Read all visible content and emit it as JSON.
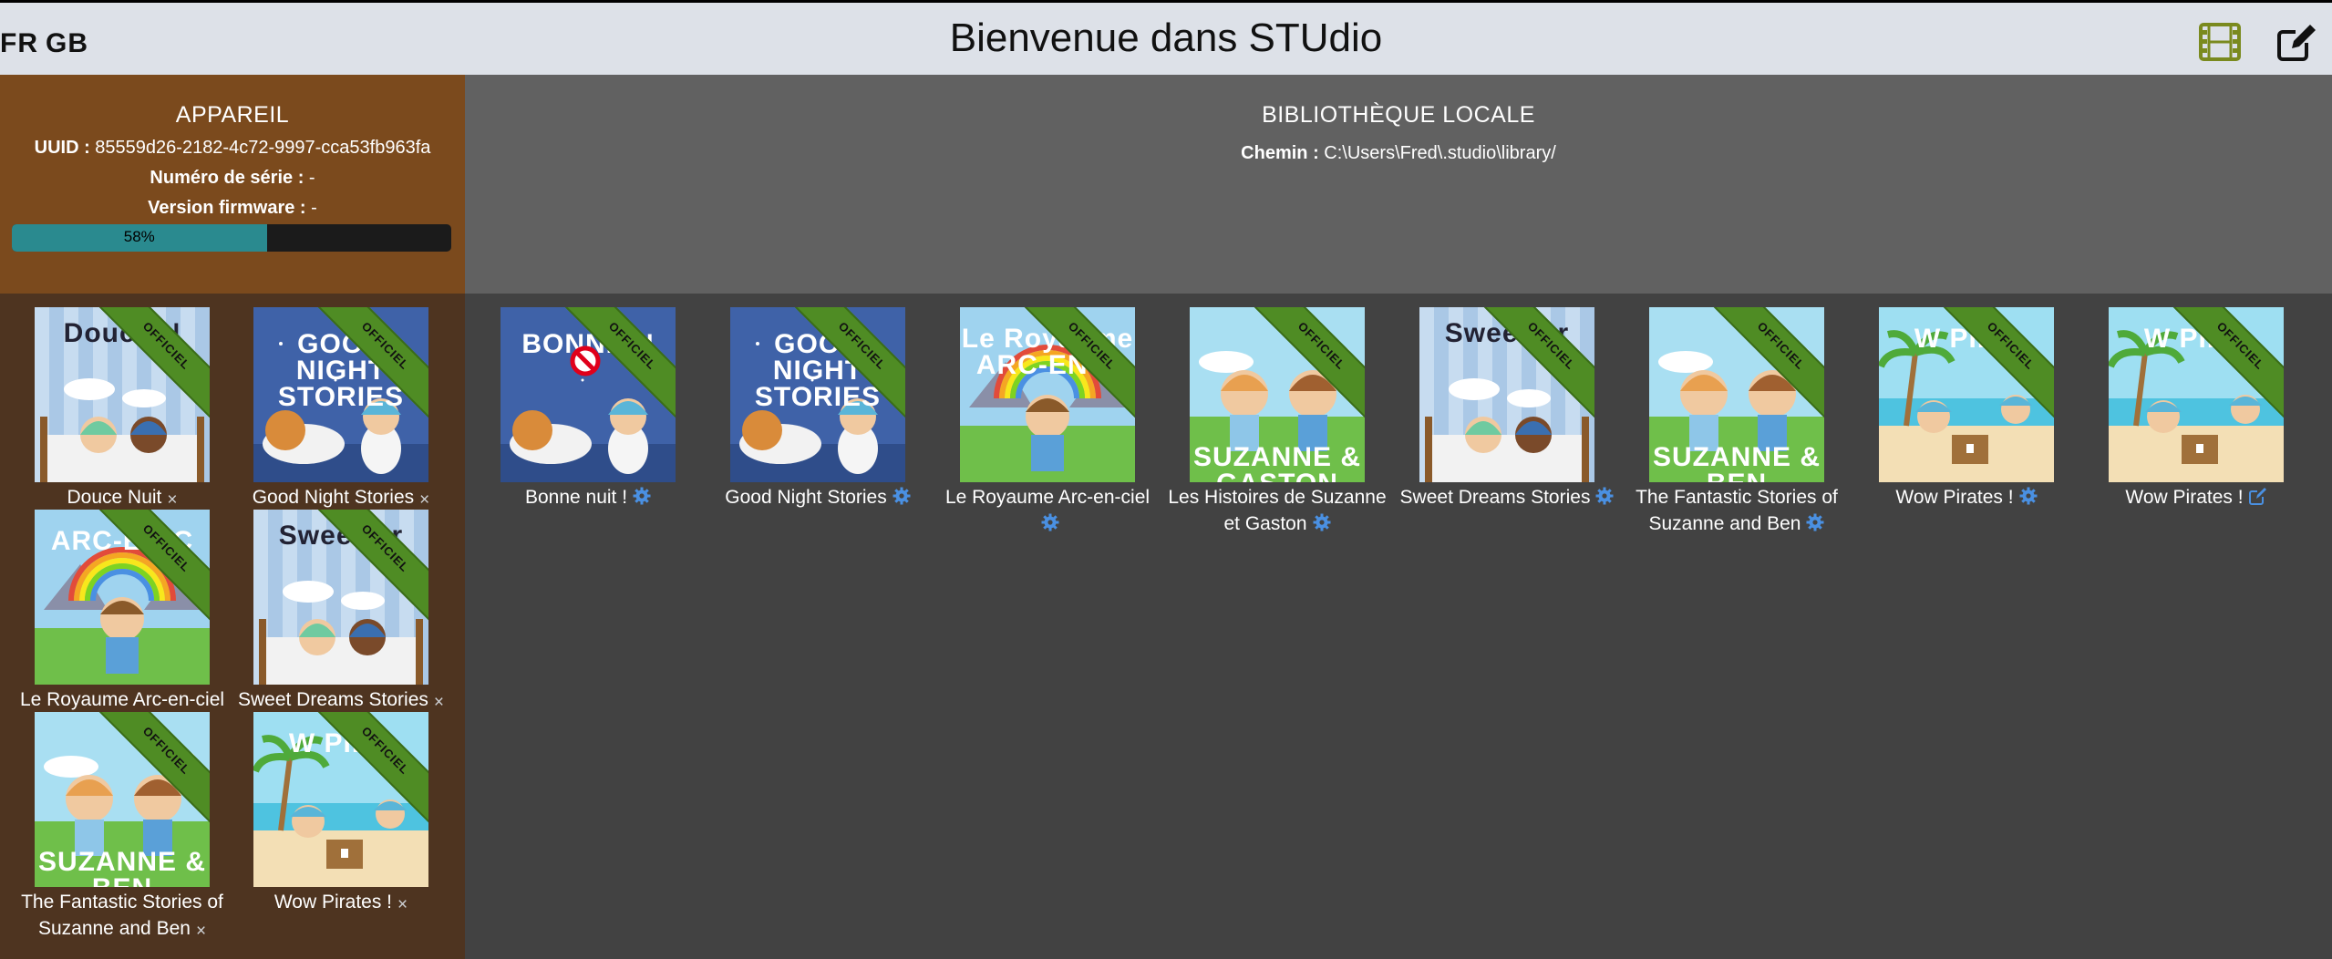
{
  "header": {
    "languages": [
      "FR",
      "GB"
    ],
    "title": "Bienvenue dans STUdio"
  },
  "device": {
    "title": "APPAREIL",
    "uuid_label": "UUID :",
    "uuid": "85559d26-2182-4c72-9997-cca53fb963fa",
    "serial_label": "Numéro de série :",
    "serial": "-",
    "firmware_label": "Version firmware :",
    "firmware": "-",
    "storage_percent": 58,
    "storage_text": "58%"
  },
  "library": {
    "title": "BIBLIOTHÈQUE LOCALE",
    "path_label": "Chemin :",
    "path": "C:\\Users\\Fred\\.studio\\library/"
  },
  "badge": "OFFICIEL",
  "device_packs": [
    {
      "label": "Douce Nuit",
      "cover": "sweet",
      "cover_text": "Douce N",
      "action": "remove"
    },
    {
      "label": "Good Night Stories",
      "cover": "night",
      "cover_text": "GOOD NIGHT STORIES",
      "action": "remove"
    },
    {
      "label": "Le Royaume Arc-en-ciel",
      "cover": "rainbow",
      "cover_text": "ARC-EN-C",
      "action": "remove"
    },
    {
      "label": "Sweet Dreams Stories",
      "cover": "sweet",
      "cover_text": "Sweet Dr",
      "action": "remove"
    },
    {
      "label": "The Fantastic Stories of Suzanne and Ben",
      "cover": "suzanne",
      "cover_text": "SUZANNE & BEN",
      "action": "remove"
    },
    {
      "label": "Wow Pirates !",
      "cover": "pirates",
      "cover_text": "W PIRA",
      "action": "remove"
    }
  ],
  "library_packs": [
    {
      "label": "Bonne nuit !",
      "cover": "night",
      "cover_text": "BONNE N",
      "action": "settings",
      "blocked": true
    },
    {
      "label": "Good Night Stories",
      "cover": "night",
      "cover_text": "GOOD NIGHT STORIES",
      "action": "settings"
    },
    {
      "label": "Le Royaume Arc-en-ciel",
      "cover": "rainbow",
      "cover_text": "Le Royaume ARC-EN-C",
      "action": "settings"
    },
    {
      "label": "Les Histoires de Suzanne et Gaston",
      "cover": "suzanne",
      "cover_text": "SUZANNE & GASTON",
      "action": "settings"
    },
    {
      "label": "Sweet Dreams Stories",
      "cover": "sweet",
      "cover_text": "Sweet Dr",
      "action": "settings"
    },
    {
      "label": "The Fantastic Stories of Suzanne and Ben",
      "cover": "suzanne",
      "cover_text": "SUZANNE & BEN",
      "action": "settings"
    },
    {
      "label": "Wow Pirates !",
      "cover": "pirates",
      "cover_text": "W PIRA",
      "action": "settings"
    },
    {
      "label": "Wow Pirates !",
      "cover": "pirates",
      "cover_text": "W PIRA",
      "action": "edit"
    }
  ]
}
